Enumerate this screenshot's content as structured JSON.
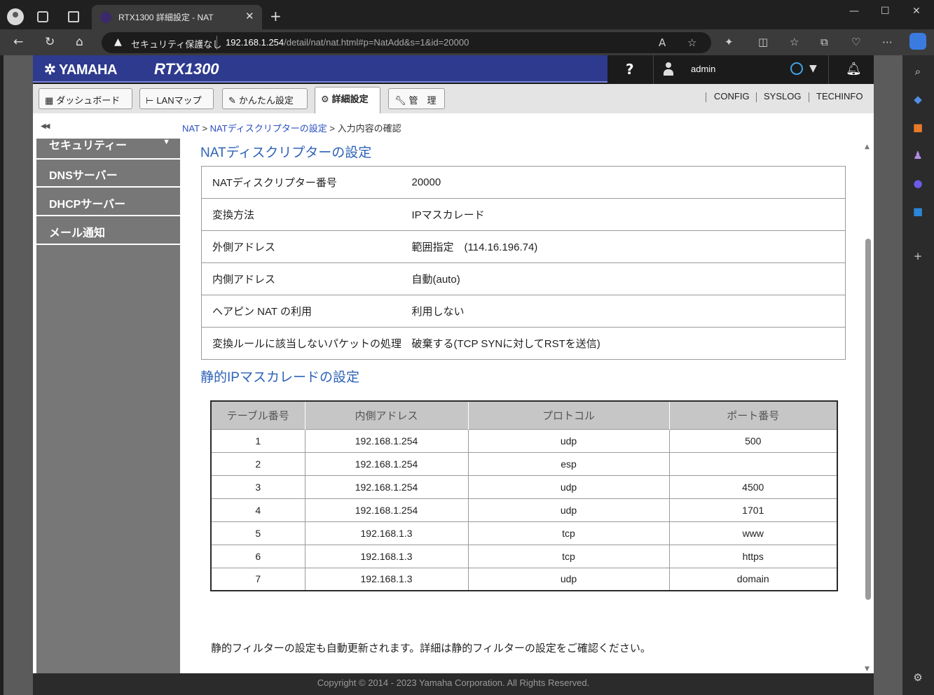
{
  "browser": {
    "tab_title": "RTX1300 詳細設定 - NAT",
    "security_label": "セキュリティ保護なし",
    "url_host": "192.168.1.254",
    "url_path": "/detail/nat/nat.html#p=NatAdd&s=1&id=20000"
  },
  "header": {
    "brand": "YAMAHA",
    "model": "RTX1300",
    "help": "?",
    "user": "admin"
  },
  "menu": {
    "dashboard": "ダッシュボード",
    "lanmap": "LANマップ",
    "easy": "かんたん設定",
    "detail": "詳細設定",
    "manage": "管　理",
    "links": [
      "CONFIG",
      "SYSLOG",
      "TECHINFO"
    ]
  },
  "sidebar": {
    "collapse": "◀◀",
    "items": [
      "セキュリティー",
      "DNSサーバー",
      "DHCPサーバー",
      "メール通知"
    ],
    "caret": "▼"
  },
  "breadcrumb": {
    "root": "NAT",
    "sep": ">",
    "parent": "NATディスクリプターの設定",
    "current": "入力内容の確認"
  },
  "section1": {
    "title": "NATディスクリプターの設定",
    "rows": [
      {
        "label": "NATディスクリプター番号",
        "value": "20000"
      },
      {
        "label": "変換方法",
        "value": "IPマスカレード"
      },
      {
        "label": "外側アドレス",
        "value": "範囲指定　(114.16.196.74)"
      },
      {
        "label": "内側アドレス",
        "value": "自動(auto)"
      },
      {
        "label": "ヘアピン NAT の利用",
        "value": "利用しない"
      },
      {
        "label": "変換ルールに該当しないパケットの処理",
        "value": "破棄する(TCP SYNに対してRSTを送信)"
      }
    ]
  },
  "section2": {
    "title": "静的IPマスカレードの設定",
    "columns": [
      "テーブル番号",
      "内側アドレス",
      "プロトコル",
      "ポート番号"
    ],
    "rows": [
      [
        "1",
        "192.168.1.254",
        "udp",
        "500"
      ],
      [
        "2",
        "192.168.1.254",
        "esp",
        ""
      ],
      [
        "3",
        "192.168.1.254",
        "udp",
        "4500"
      ],
      [
        "4",
        "192.168.1.254",
        "udp",
        "1701"
      ],
      [
        "5",
        "192.168.1.3",
        "tcp",
        "www"
      ],
      [
        "6",
        "192.168.1.3",
        "tcp",
        "https"
      ],
      [
        "7",
        "192.168.1.3",
        "udp",
        "domain"
      ]
    ]
  },
  "note": "静的フィルターの設定も自動更新されます。詳細は静的フィルターの設定をご確認ください。",
  "footer": "Copyright © 2014 - 2023 Yamaha Corporation. All Rights Reserved.",
  "colors": {
    "header_blue": "#2d3a8e",
    "link_blue": "#2d62b8",
    "nav_gray": "#777777"
  }
}
